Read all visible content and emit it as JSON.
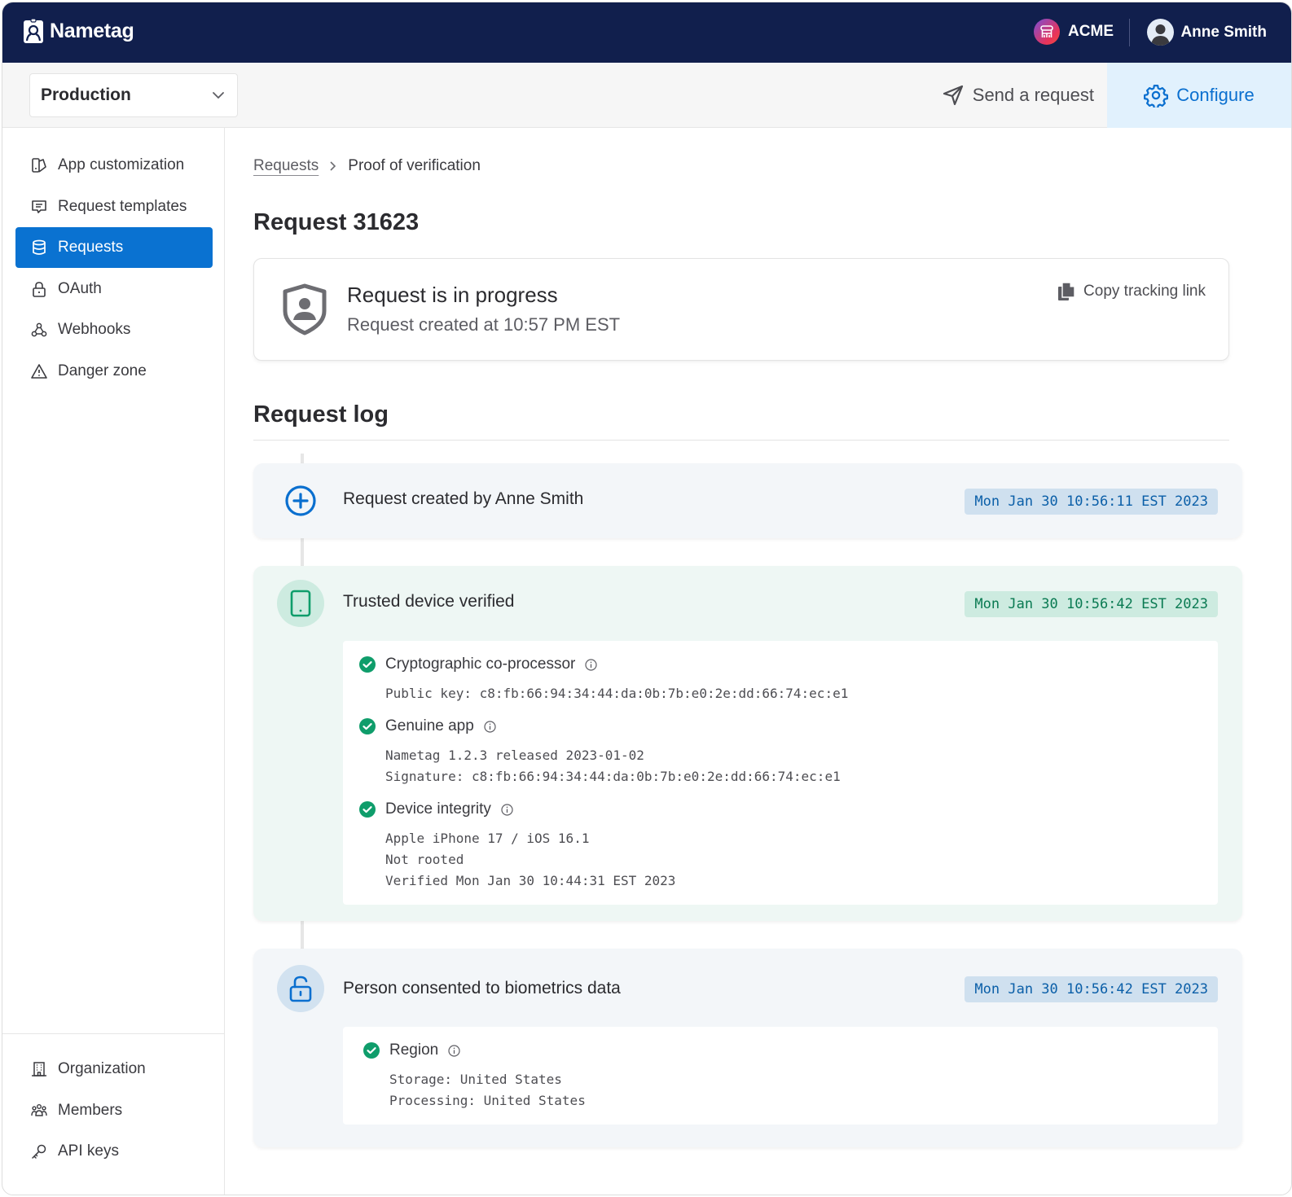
{
  "app": {
    "name": "Nametag",
    "org_name": "ACME",
    "user_name": "Anne Smith"
  },
  "subbar": {
    "environment": "Production",
    "send_request_label": "Send a request",
    "configure_label": "Configure"
  },
  "sidebar": {
    "items": [
      {
        "label": "App customization",
        "icon": "palette-icon",
        "active": false
      },
      {
        "label": "Request templates",
        "icon": "message-square-icon",
        "active": false
      },
      {
        "label": "Requests",
        "icon": "database-icon",
        "active": true
      },
      {
        "label": "OAuth",
        "icon": "lock-icon",
        "active": false
      },
      {
        "label": "Webhooks",
        "icon": "webhook-icon",
        "active": false
      },
      {
        "label": "Danger zone",
        "icon": "warning-triangle-icon",
        "active": false
      }
    ],
    "bottom_items": [
      {
        "label": "Organization",
        "icon": "building-icon"
      },
      {
        "label": "Members",
        "icon": "users-icon"
      },
      {
        "label": "API keys",
        "icon": "key-icon"
      }
    ]
  },
  "breadcrumb": {
    "parent": "Requests",
    "current": "Proof of verification"
  },
  "page_title": "Request 31623",
  "status": {
    "title": "Request is in progress",
    "subtitle": "Request created at 10:57 PM EST",
    "copy_link_label": "Copy tracking link"
  },
  "log": {
    "title": "Request log",
    "entries": [
      {
        "text": "Request created by Anne Smith",
        "timestamp": "Mon Jan 30 10:56:11 EST 2023",
        "icon": "plus-circle-icon",
        "tone": "blue"
      },
      {
        "text": "Trusted device verified",
        "timestamp": "Mon Jan 30 10:56:42 EST 2023",
        "icon": "phone-icon",
        "tone": "green",
        "checks": [
          {
            "label": "Cryptographic co-processor",
            "lines": [
              "Public key: c8:fb:66:94:34:44:da:0b:7b:e0:2e:dd:66:74:ec:e1"
            ]
          },
          {
            "label": "Genuine app",
            "lines": [
              "Nametag 1.2.3 released 2023-01-02",
              "Signature: c8:fb:66:94:34:44:da:0b:7b:e0:2e:dd:66:74:ec:e1"
            ]
          },
          {
            "label": "Device integrity",
            "lines": [
              "Apple iPhone 17 / iOS 16.1",
              "Not rooted",
              "Verified Mon Jan 30 10:44:31 EST 2023"
            ]
          }
        ]
      },
      {
        "text": "Person consented to biometrics data",
        "timestamp": "Mon Jan 30 10:56:42 EST 2023",
        "icon": "unlock-icon",
        "tone": "blue",
        "checks": [
          {
            "label": "Region",
            "lines": [
              "Storage: United States",
              "Processing: United States"
            ]
          }
        ]
      }
    ]
  },
  "colors": {
    "nav_bg": "#111f4d",
    "accent": "#0a72d1",
    "success": "#0f9d6b",
    "configure_bg": "#e1f1fd"
  }
}
